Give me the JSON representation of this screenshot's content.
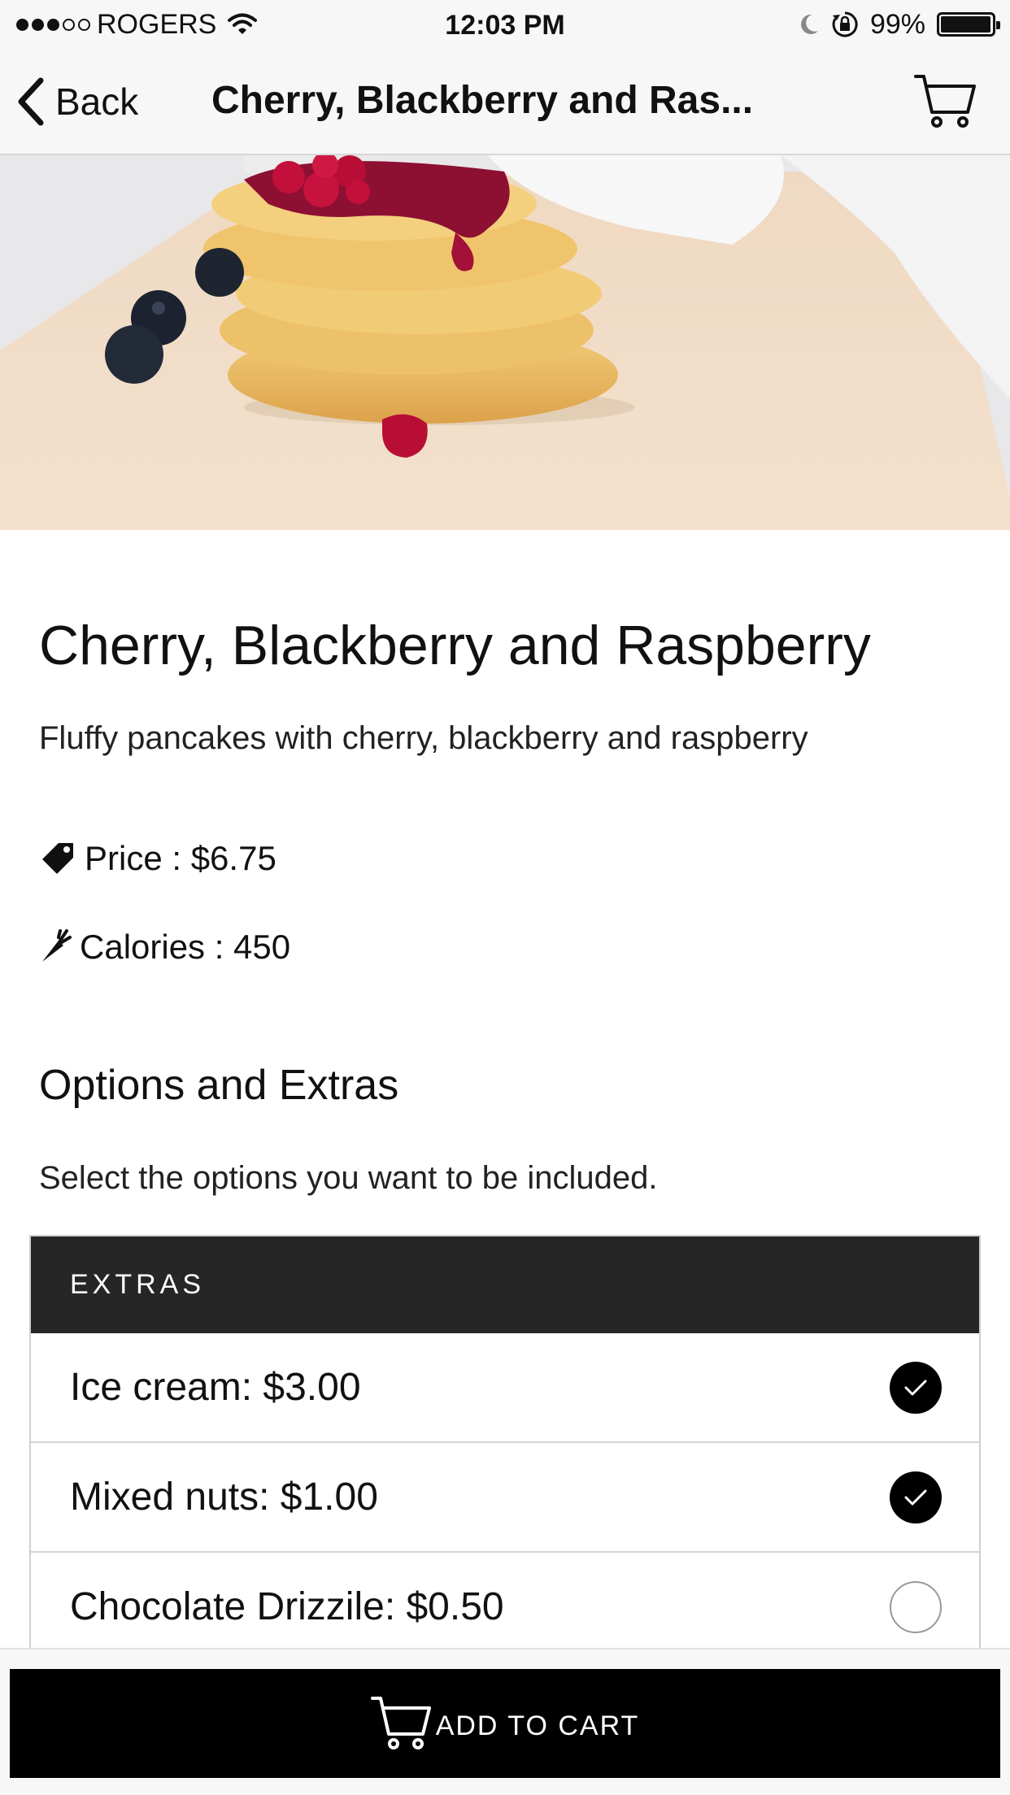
{
  "status_bar": {
    "carrier": "ROGERS",
    "time": "12:03 PM",
    "battery": "99%",
    "battery_level": 0.99
  },
  "nav": {
    "back_label": "Back",
    "title": "Cherry, Blackberry and Ras...",
    "cart_icon": "cart-icon"
  },
  "product": {
    "title": "Cherry, Blackberry and Raspberry",
    "description": "Fluffy pancakes with cherry, blackberry and raspberry",
    "price": "Price : $6.75",
    "calories": "Calories : 450"
  },
  "options": {
    "heading": "Options and Extras",
    "subheading": "Select the options you want to be included.",
    "group_label": "EXTRAS",
    "items": [
      {
        "label": "Ice cream: $3.00",
        "selected": true
      },
      {
        "label": "Mixed nuts: $1.00",
        "selected": true
      },
      {
        "label": "Chocolate Drizzile: $0.50",
        "selected": false
      }
    ]
  },
  "footer": {
    "add_to_cart_label": "ADD TO CART"
  },
  "colors": {
    "bar_background": "#f7f7f7",
    "header_dark": "#262626",
    "button_black": "#000000",
    "berry_red": "#c2103a"
  }
}
